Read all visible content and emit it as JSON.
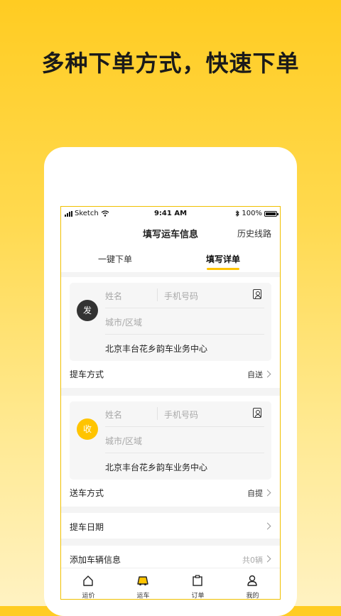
{
  "headline": "多种下单方式，快速下单",
  "status_bar": {
    "carrier": "Sketch",
    "time": "9:41 AM",
    "battery": "100%"
  },
  "nav": {
    "title": "填写运车信息",
    "history": "历史线路"
  },
  "tabs": [
    {
      "label": "一键下单"
    },
    {
      "label": "填写详单",
      "active": true
    }
  ],
  "sender": {
    "badge": "发",
    "name_placeholder": "姓名",
    "phone_placeholder": "手机号码",
    "city_placeholder": "城市/区域",
    "address": "北京丰台花乡韵车业务中心",
    "method_label": "提车方式",
    "method_value": "自送"
  },
  "receiver": {
    "badge": "收",
    "name_placeholder": "姓名",
    "phone_placeholder": "手机号码",
    "city_placeholder": "城市/区域",
    "address": "北京丰台花乡韵车业务中心",
    "method_label": "送车方式",
    "method_value": "自提"
  },
  "pickup_date": {
    "label": "提车日期"
  },
  "vehicles": {
    "label": "添加车辆信息",
    "count": "共0辆"
  },
  "tabbar": [
    {
      "label": "运价",
      "icon": "home-icon"
    },
    {
      "label": "运车",
      "icon": "car-icon",
      "active": true
    },
    {
      "label": "订单",
      "icon": "clipboard-icon"
    },
    {
      "label": "我的",
      "icon": "user-icon"
    }
  ],
  "colors": {
    "accent": "#FFC400",
    "sender_badge": "#333333",
    "receiver_badge": "#FFC400"
  }
}
